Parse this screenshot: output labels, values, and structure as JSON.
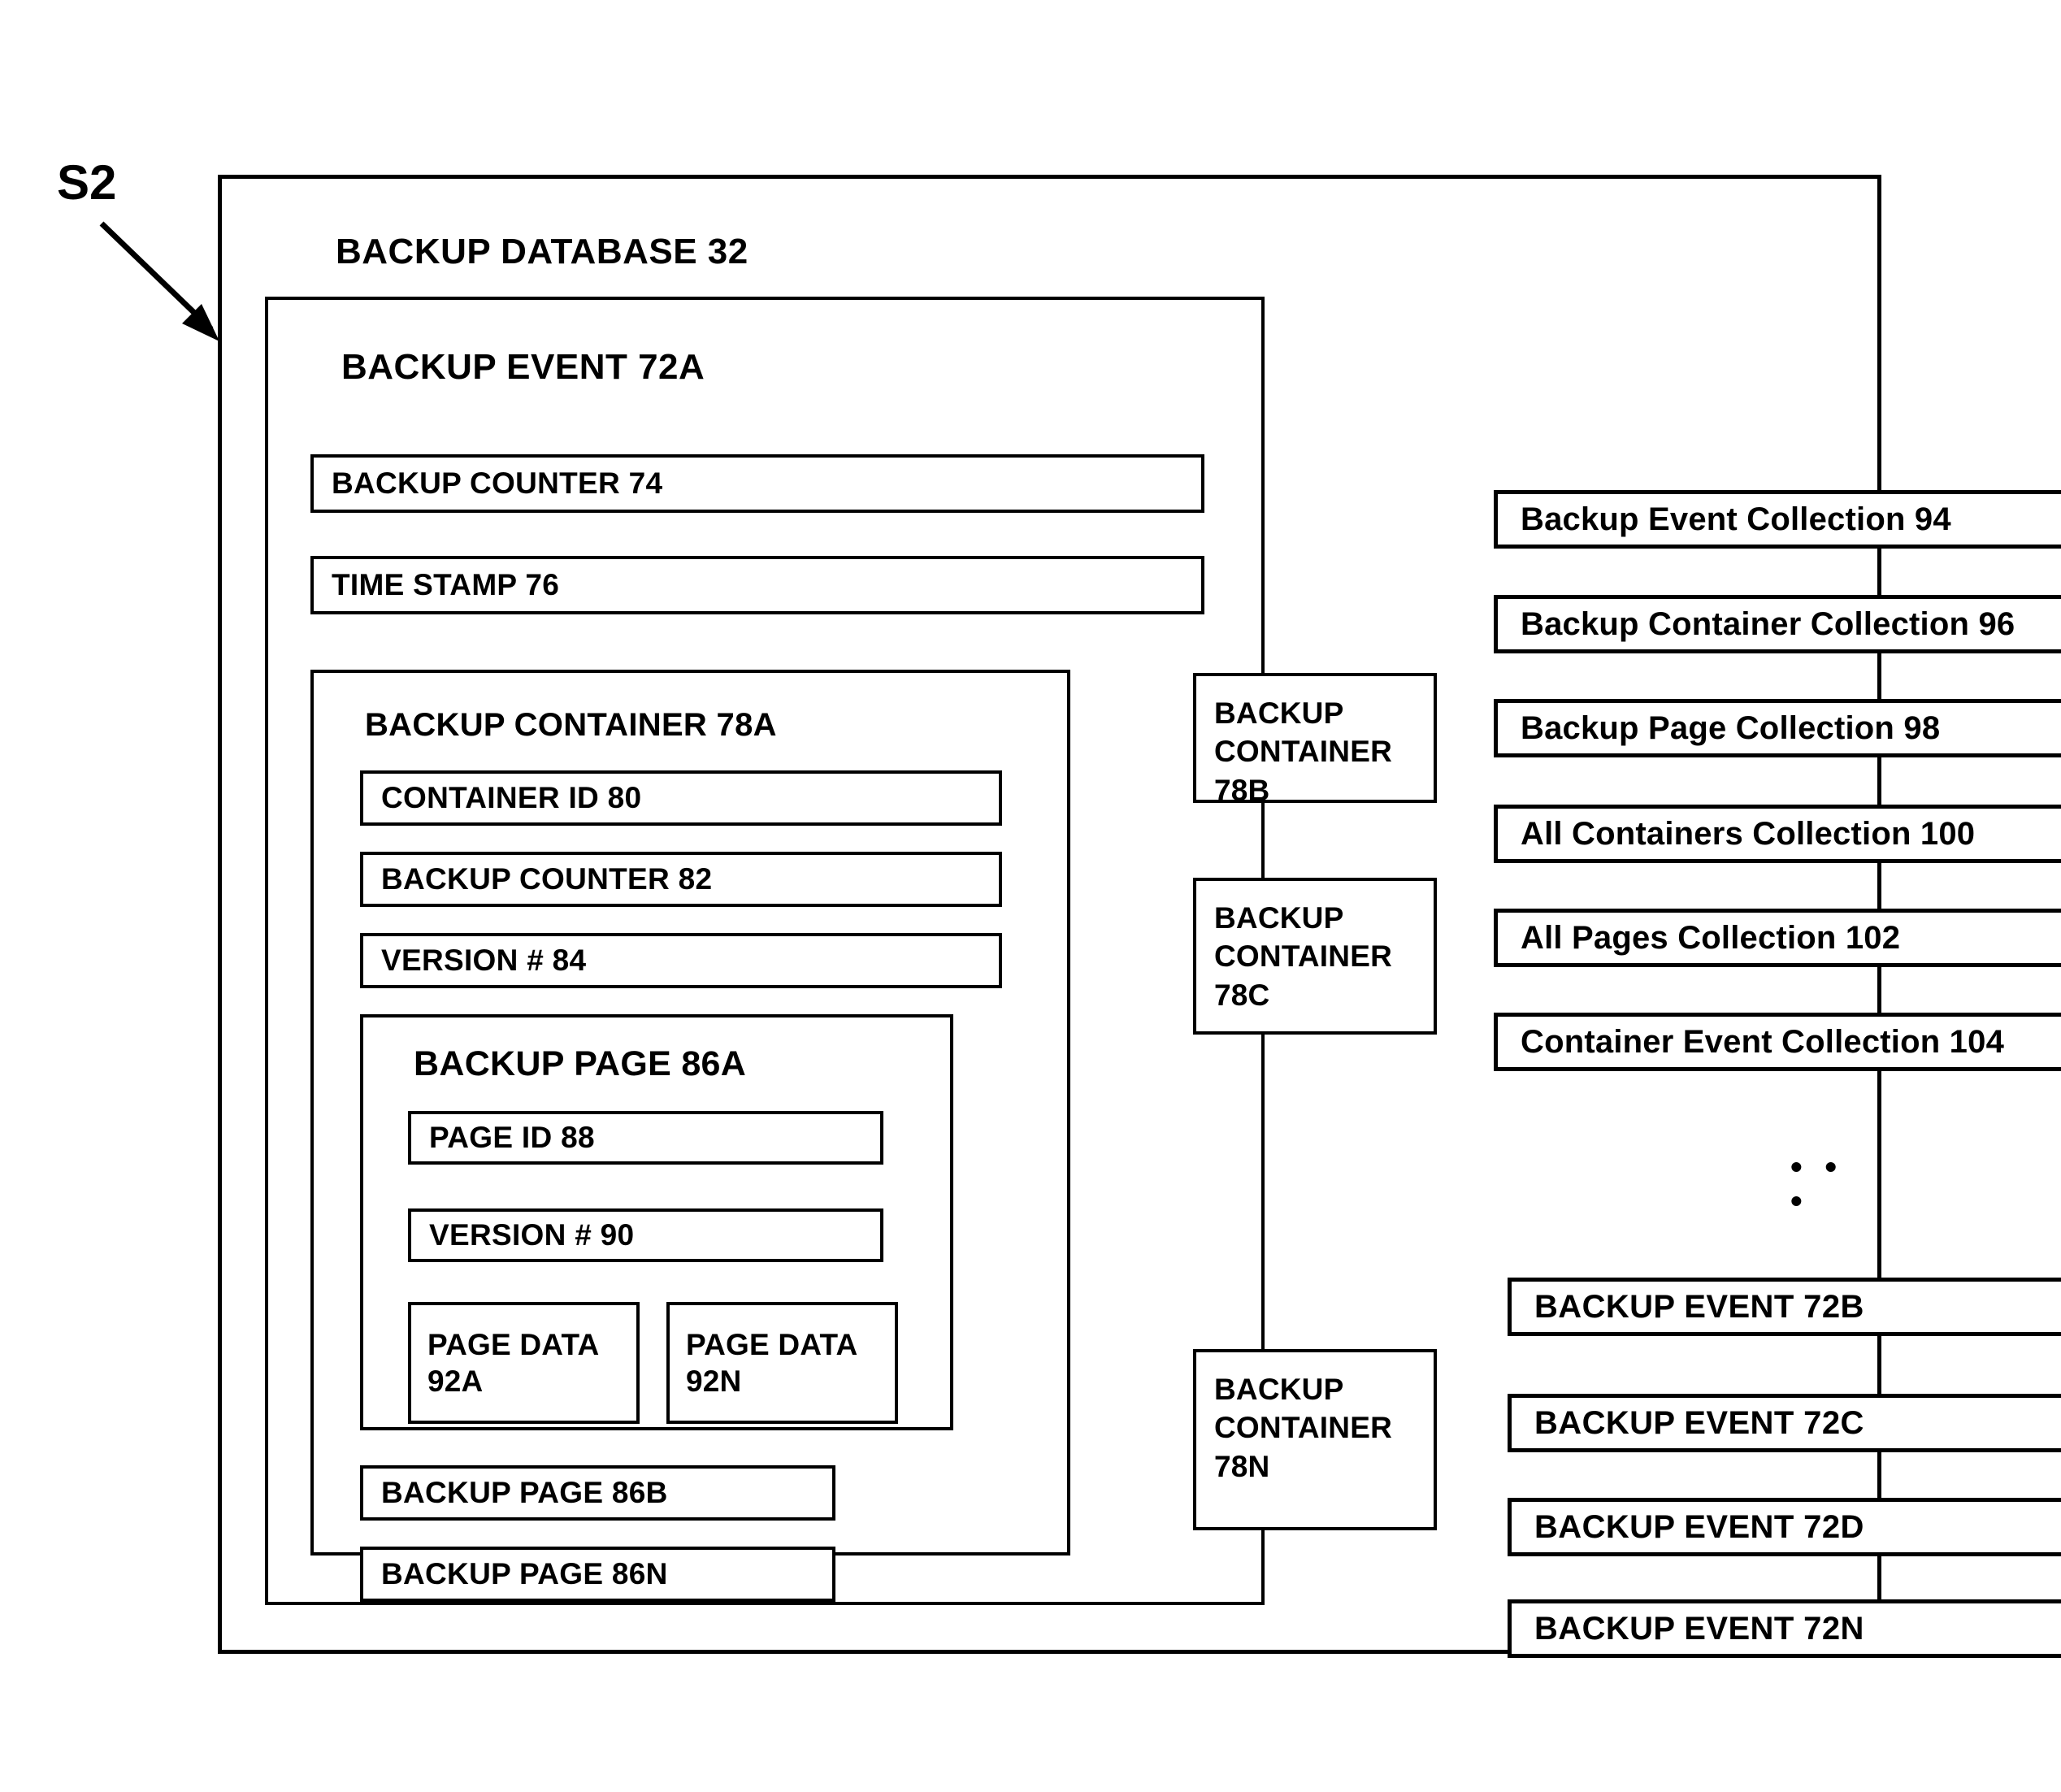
{
  "figure": {
    "reference_label": "S2"
  },
  "database": {
    "title": "BACKUP DATABASE 32"
  },
  "backup_event_72a": {
    "title": "BACKUP EVENT 72A",
    "fields": [
      {
        "label": "BACKUP COUNTER 74"
      },
      {
        "label": "TIME STAMP 76"
      }
    ],
    "container_78a": {
      "title": "BACKUP CONTAINER 78A",
      "fields": [
        {
          "label": "CONTAINER ID 80"
        },
        {
          "label": "BACKUP COUNTER 82"
        },
        {
          "label": "VERSION # 84"
        }
      ],
      "page_86a": {
        "title": "BACKUP PAGE 86A",
        "fields": [
          {
            "label": "PAGE ID 88"
          },
          {
            "label": "VERSION # 90"
          }
        ],
        "page_data": [
          {
            "label": "PAGE DATA 92A"
          },
          {
            "label": "PAGE DATA 92N"
          }
        ]
      },
      "other_pages": [
        {
          "label": "BACKUP PAGE 86B"
        },
        {
          "label": "BACKUP PAGE 86N"
        }
      ]
    }
  },
  "other_containers": [
    {
      "label": "BACKUP CONTAINER 78B"
    },
    {
      "label": "BACKUP CONTAINER 78C"
    },
    {
      "label": "BACKUP CONTAINER 78N"
    }
  ],
  "collections": [
    {
      "label": "Backup Event Collection 94"
    },
    {
      "label": "Backup Container Collection 96"
    },
    {
      "label": "Backup Page Collection 98"
    },
    {
      "label": "All Containers Collection 100"
    },
    {
      "label": "All Pages Collection 102"
    },
    {
      "label": "Container Event Collection 104"
    }
  ],
  "ellipsis": "• • •",
  "other_events": [
    {
      "label": "BACKUP EVENT 72B"
    },
    {
      "label": "BACKUP EVENT 72C"
    },
    {
      "label": "BACKUP EVENT 72D"
    },
    {
      "label": "BACKUP EVENT 72N"
    }
  ],
  "colors": {
    "stroke": "#000000",
    "background": "#ffffff"
  }
}
